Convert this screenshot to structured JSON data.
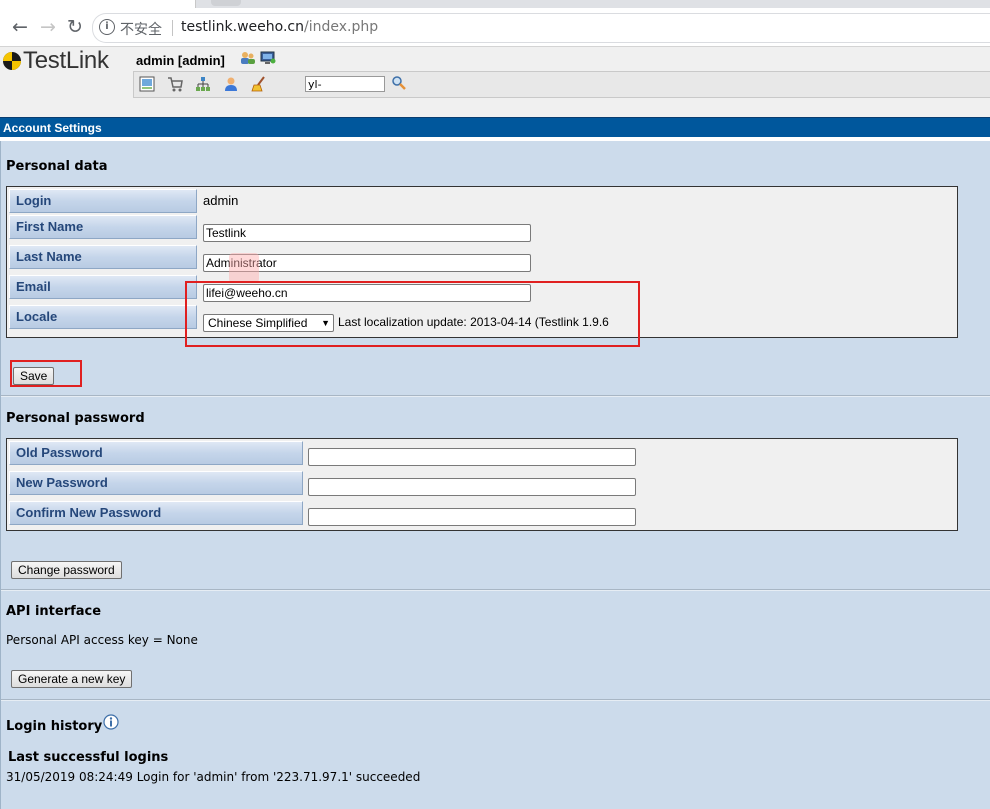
{
  "browser": {
    "security_label": "不安全",
    "url_host": "testlink.weeho.cn",
    "url_path": "/index.php"
  },
  "header": {
    "logo_text": "TestLink",
    "user_label": "admin [admin]",
    "search_value": "yl-"
  },
  "title_bar": "Account Settings",
  "personal_data": {
    "heading": "Personal data",
    "login_label": "Login",
    "login_value": "admin",
    "first_name_label": "First Name",
    "first_name_value": "Testlink",
    "last_name_label": "Last Name",
    "last_name_value": "Administrator",
    "email_label": "Email",
    "email_value": "lifei@weeho.cn",
    "locale_label": "Locale",
    "locale_value": "Chinese Simplified",
    "locale_note": "Last localization update: 2013-04-14 (Testlink 1.9.6",
    "save_label": "Save"
  },
  "personal_password": {
    "heading": "Personal password",
    "old_label": "Old Password",
    "new_label": "New Password",
    "confirm_label": "Confirm New Password",
    "button_label": "Change password"
  },
  "api": {
    "heading": "API interface",
    "key_text": "Personal API access key = None",
    "button_label": "Generate a new key"
  },
  "login_history": {
    "heading": "Login history",
    "subheading": "Last successful logins",
    "entries": [
      "31/05/2019 08:24:49 Login for 'admin' from '223.71.97.1' succeeded"
    ]
  },
  "colors": {
    "title_bar": "#00579c",
    "workarea": "#ccdbeb",
    "label_text": "#25477a",
    "highlight": "#e02020"
  },
  "icons": [
    "back-arrow-icon",
    "forward-arrow-icon",
    "reload-icon",
    "info-icon",
    "logo-icon",
    "users-icon",
    "monitor-icon",
    "desktop-icon",
    "cart-icon",
    "hierarchy-icon",
    "user-icon",
    "broom-icon",
    "search-icon",
    "help-info-icon"
  ]
}
